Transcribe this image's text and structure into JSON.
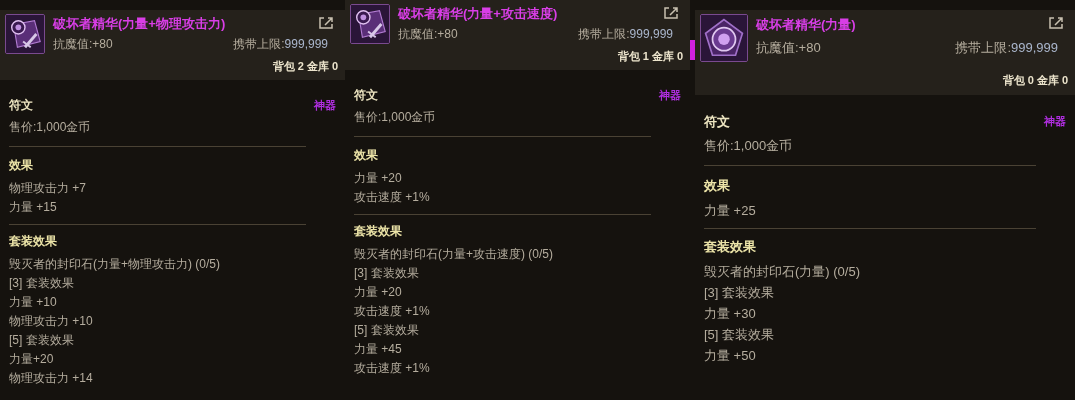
{
  "panels": [
    {
      "title": "破坏者精华(力量+物理攻击力)",
      "resist": "抗魔值:+80",
      "carry_label": "携带上限:",
      "carry_value": "999,999",
      "storage": "背包 2 金库 0",
      "category": "符文",
      "rarity": "神器",
      "price": "售价:1,000金币",
      "effect_heading": "效果",
      "effects": [
        "物理攻击力 +7",
        "力量 +15"
      ],
      "set_heading": "套装效果",
      "set_lines": [
        "毁灭者的封印石(力量+物理攻击力) (0/5)",
        "[3] 套装效果",
        "力量 +10",
        "物理攻击力 +10",
        "[5] 套装效果",
        "力量+20",
        "物理攻击力 +14"
      ]
    },
    {
      "title": "破坏者精华(力量+攻击速度)",
      "resist": "抗魔值:+80",
      "carry_label": "携带上限:",
      "carry_value": "999,999",
      "storage": "背包 1 金库 0",
      "category": "符文",
      "rarity": "神器",
      "price": "售价:1,000金币",
      "effect_heading": "效果",
      "effects": [
        "力量 +20",
        "攻击速度 +1%"
      ],
      "set_heading": "套装效果",
      "set_lines": [
        "毁灭者的封印石(力量+攻击速度) (0/5)",
        "[3] 套装效果",
        "力量 +20",
        "攻击速度 +1%",
        "[5] 套装效果",
        "力量 +45",
        "攻击速度 +1%"
      ]
    },
    {
      "title": "破坏者精华(力量)",
      "resist": "抗魔值:+80",
      "carry_label": "携带上限:",
      "carry_value": "999,999",
      "storage": "背包 0 金库 0",
      "category": "符文",
      "rarity": "神器",
      "price": "售价:1,000金币",
      "effect_heading": "效果",
      "effects": [
        "力量 +25"
      ],
      "set_heading": "套装效果",
      "set_lines": [
        "毁灭者的封印石(力量) (0/5)",
        "[3] 套装效果",
        "力量 +30",
        "[5] 套装效果",
        "力量 +50"
      ]
    }
  ]
}
